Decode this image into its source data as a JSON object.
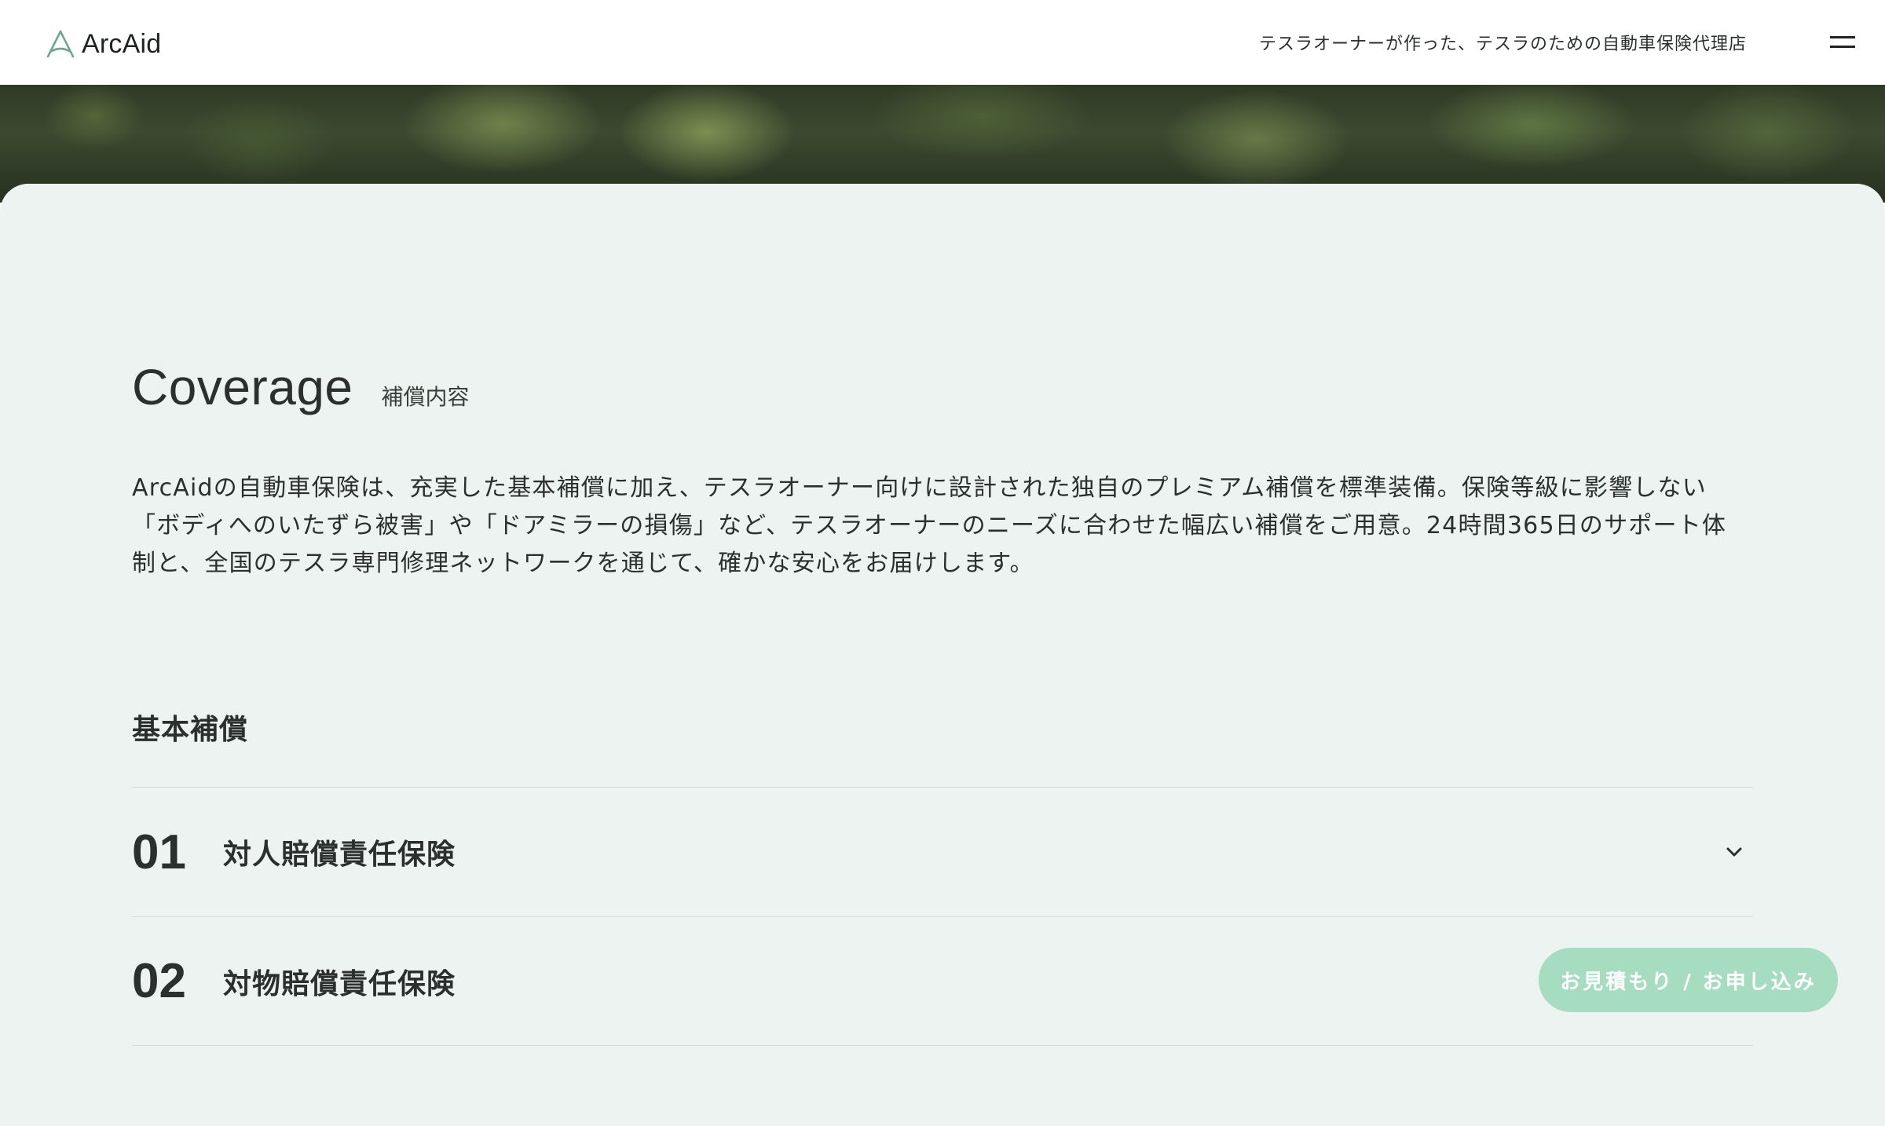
{
  "header": {
    "logo_text": "ArcAid",
    "tagline": "テスラオーナーが作った、テスラのための自動車保険代理店",
    "menu_icon": "hamburger-menu-icon"
  },
  "coverage": {
    "title_en": "Coverage",
    "title_ja": "補償内容",
    "intro": "ArcAidの自動車保険は、充実した基本補償に加え、テスラオーナー向けに設計された独自のプレミアム補償を標準装備。保険等級に影響しない「ボディへのいたずら被害」や「ドアミラーの損傷」など、テスラオーナーのニーズに合わせた幅広い補償をご用意。24時間365日のサポート体制と、全国のテスラ専門修理ネットワークを通じて、確かな安心をお届けします。",
    "basic_heading": "基本補償",
    "items": [
      {
        "number": "01",
        "label": "対人賠償責任保険",
        "icon": "chevron-down-icon"
      },
      {
        "number": "02",
        "label": "対物賠償責任保険",
        "icon": "chevron-down-icon"
      }
    ]
  },
  "cta": {
    "label": "お見積もり / お申し込み"
  },
  "colors": {
    "panel_bg": "#edf3f0",
    "cta_bg": "#a6dcbf",
    "logo_mark": "#6fa88f",
    "text": "#2b2f2d"
  }
}
